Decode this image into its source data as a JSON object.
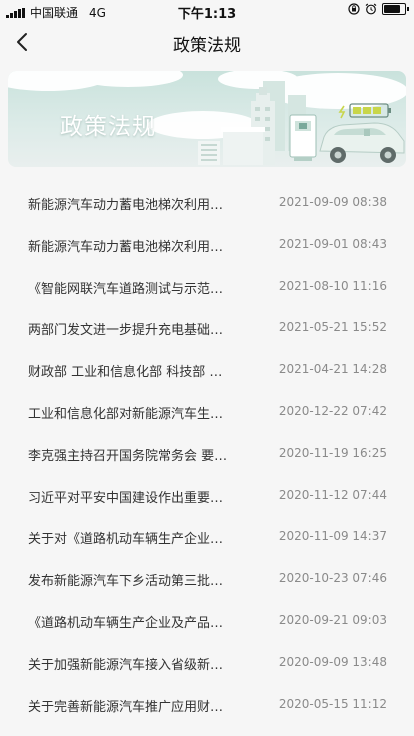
{
  "status_bar": {
    "carrier": "中国联通",
    "network": "4G",
    "time": "下午1:13",
    "battery_level": 0.9
  },
  "header": {
    "title": "政策法规"
  },
  "banner": {
    "title": "政策法规"
  },
  "policies": [
    {
      "title": "新能源汽车动力蓄电池梯次利用…",
      "date": "2021-09-09 08:38"
    },
    {
      "title": "新能源汽车动力蓄电池梯次利用…",
      "date": "2021-09-01 08:43"
    },
    {
      "title": "《智能网联汽车道路测试与示范…",
      "date": "2021-08-10 11:16"
    },
    {
      "title": "两部门发文进一步提升充电基础…",
      "date": "2021-05-21 15:52"
    },
    {
      "title": "财政部 工业和信息化部 科技部 …",
      "date": "2021-04-21 14:28"
    },
    {
      "title": "工业和信息化部对新能源汽车生…",
      "date": "2020-12-22 07:42"
    },
    {
      "title": "李克强主持召开国务院常务会 要…",
      "date": "2020-11-19 16:25"
    },
    {
      "title": "习近平对平安中国建设作出重要…",
      "date": "2020-11-12 07:44"
    },
    {
      "title": "关于对《道路机动车辆生产企业…",
      "date": "2020-11-09 14:37"
    },
    {
      "title": "发布新能源汽车下乡活动第三批…",
      "date": "2020-10-23 07:46"
    },
    {
      "title": "《道路机动车辆生产企业及产品…",
      "date": "2020-09-21 09:03"
    },
    {
      "title": "关于加强新能源汽车接入省级新…",
      "date": "2020-09-09 13:48"
    },
    {
      "title": "关于完善新能源汽车推广应用财…",
      "date": "2020-05-15 11:12"
    }
  ]
}
